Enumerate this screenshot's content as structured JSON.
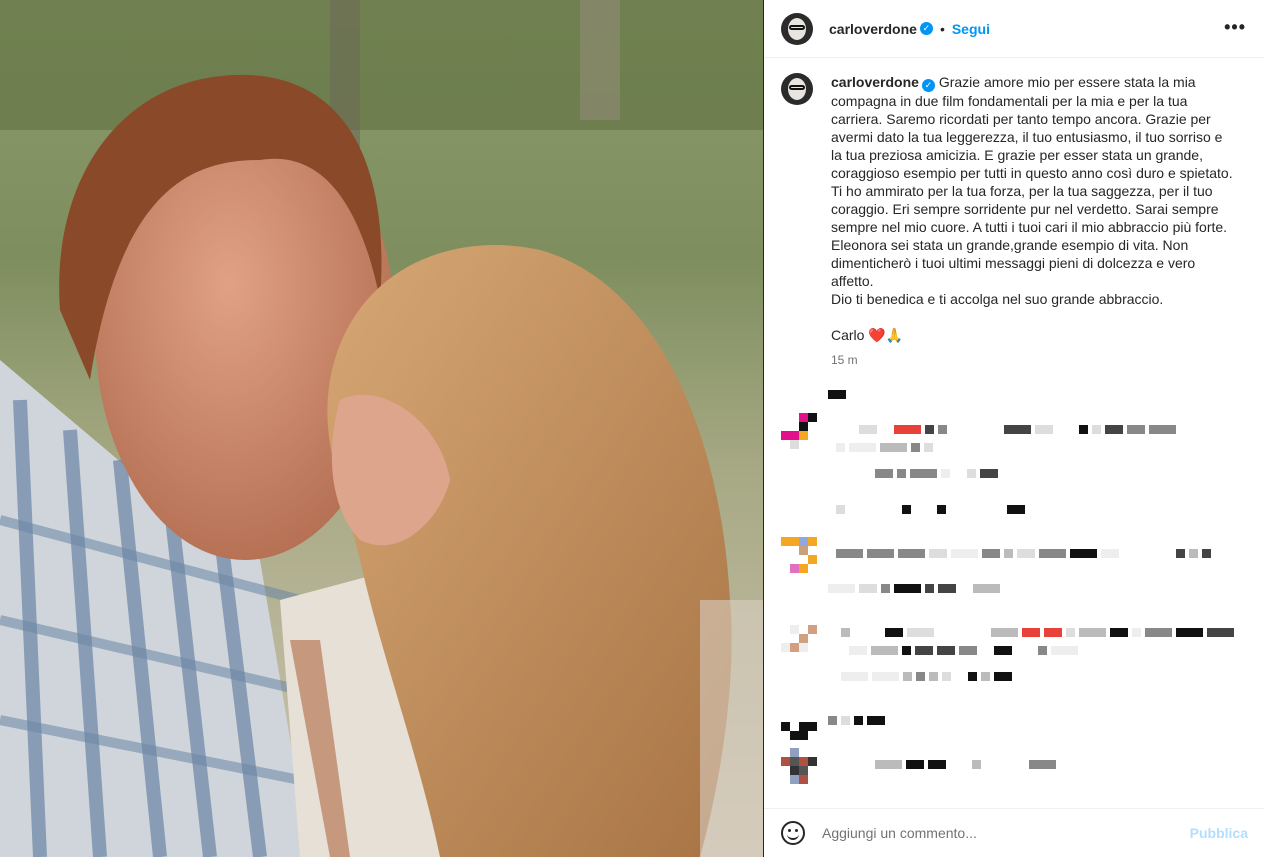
{
  "post": {
    "username": "carloverdone",
    "verified_icon": "verified-badge-icon",
    "follow_label": "Segui",
    "separator": "•",
    "more_icon": "more-options-icon",
    "more_glyph": "•••",
    "caption": "Grazie amore mio per essere stata la mia compagna in due film fondamentali per la mia e per la tua carriera. Saremo ricordati per tanto tempo ancora. Grazie per avermi dato la tua leggerezza, il tuo entusiasmo, il tuo sorriso e la tua preziosa amicizia. E grazie per esser stata un grande, coraggioso esempio per tutti in questo anno così duro e spietato. Ti ho ammirato per la tua forza, per la tua saggezza, per il tuo coraggio. Eri sempre sorridente pur nel verdetto. Sarai sempre sempre nel mio cuore. A tutti i tuoi cari il mio abbraccio più forte. Eleonora sei stata un grande,grande esempio di vita. Non dimenticherò i tuoi ultimi messaggi pieni di dolcezza e vero affetto.\nDio ti benedica e ti accolga nel suo grande abbraccio.\n\nCarlo ❤️🙏",
    "timestamp": "15 m"
  },
  "composer": {
    "emoji_icon": "emoji-smiley-icon",
    "placeholder": "Aggiungi un commento...",
    "publish_label": "Pubblica"
  },
  "colors": {
    "accent": "#0095f6",
    "publish_disabled": "#b2dffc",
    "divider": "#efefef"
  }
}
